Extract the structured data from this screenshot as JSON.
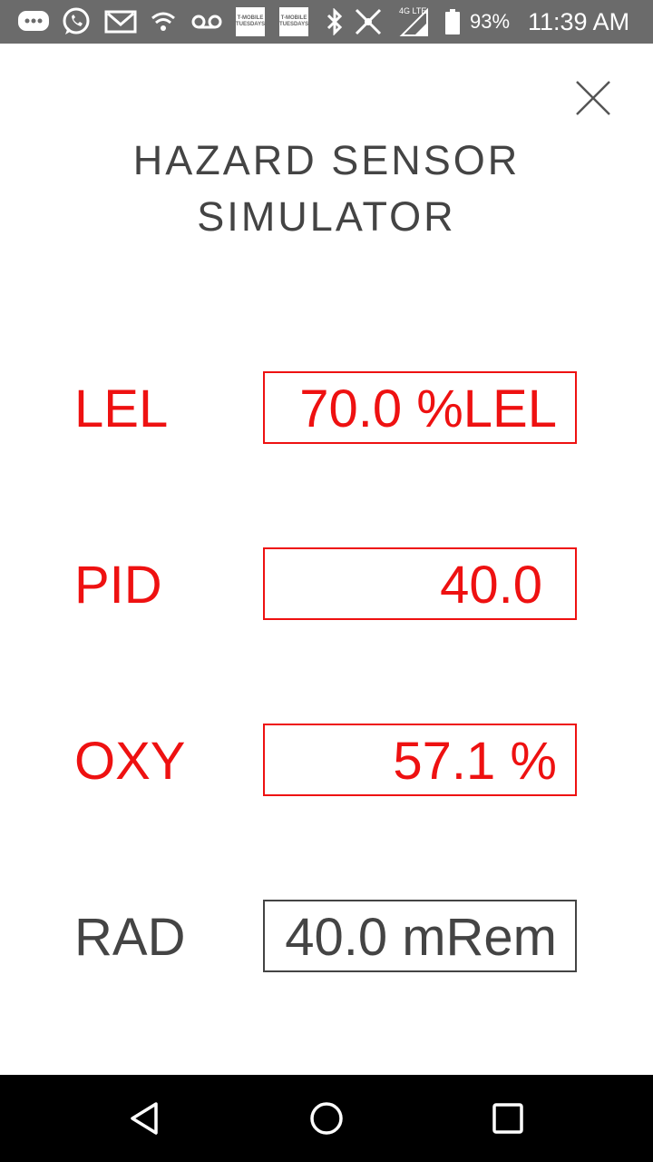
{
  "status_bar": {
    "battery_percent": "93%",
    "time": "11:39 AM",
    "network_label": "4G LTE",
    "tmobile_badge_1": "T-MOBILE TUESDAYS",
    "tmobile_badge_2": "T-MOBILE TUESDAYS",
    "icons": [
      "chat-icon",
      "whatsapp-icon",
      "gmail-icon",
      "wifi-icon",
      "voicemail-icon",
      "tmobile-tuesdays-icon",
      "tmobile-tuesdays-icon",
      "bluetooth-icon",
      "no-signal-icon",
      "signal-icon",
      "battery-icon"
    ]
  },
  "title": {
    "line1": "HAZARD SENSOR",
    "line2": "SIMULATOR"
  },
  "sensors": [
    {
      "label": "LEL",
      "value": "70.0 %LEL",
      "state": "alarm"
    },
    {
      "label": "PID",
      "value": "40.0",
      "state": "alarm"
    },
    {
      "label": "OXY",
      "value": "57.1 %",
      "state": "alarm"
    },
    {
      "label": "RAD",
      "value": "40.0 mRem",
      "state": "normal"
    }
  ],
  "colors": {
    "alarm": "#ee1111",
    "normal": "#444444",
    "status_bar": "#6b6b6b",
    "nav_bar": "#000000"
  },
  "nav_bar": {
    "buttons": [
      "back-icon",
      "home-icon",
      "recents-icon"
    ]
  }
}
